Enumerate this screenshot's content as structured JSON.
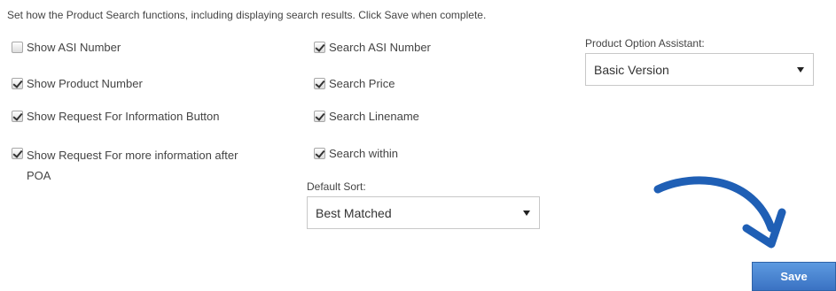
{
  "intro_text": "Set how the Product Search functions, including displaying search results. Click Save when complete.",
  "left_column": [
    {
      "label": "Show ASI Number",
      "checked": false
    },
    {
      "label": "Show Product Number",
      "checked": true
    },
    {
      "label": "Show Request For Information Button",
      "checked": true
    },
    {
      "label": "Show Request For more information after POA",
      "checked": true
    }
  ],
  "middle_column": [
    {
      "label": "Search ASI Number",
      "checked": true
    },
    {
      "label": "Search Price",
      "checked": true
    },
    {
      "label": "Search Linename",
      "checked": true
    },
    {
      "label": "Search within",
      "checked": true
    }
  ],
  "default_sort": {
    "label": "Default Sort:",
    "value": "Best Matched"
  },
  "product_option_assistant": {
    "label": "Product Option Assistant:",
    "value": "Basic Version"
  },
  "save_label": "Save",
  "colors": {
    "save_button": "#3a72c3",
    "arrow": "#1f5fb5"
  },
  "icons": {
    "arrow": "curved-arrow-icon",
    "caret": "chevron-down-icon"
  }
}
